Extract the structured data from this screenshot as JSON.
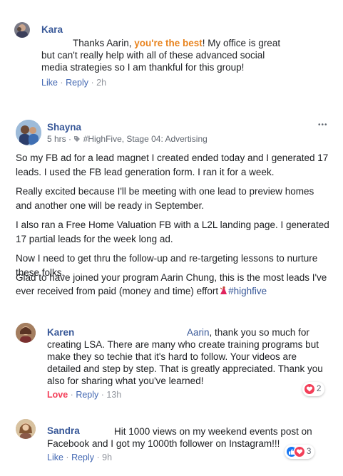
{
  "comment1": {
    "author": "Kara",
    "text_pre": "Thanks Aarin, ",
    "text_highlight": "you're the best",
    "text_post": "! My office is great",
    "line2": "but can't really help with all of these advanced social",
    "line3": "media strategies so I am thankful for this group!",
    "like": "Like",
    "reply": "Reply",
    "time": "2h"
  },
  "post": {
    "author": "Shayna",
    "time": "5 hrs",
    "tag": "#HighFive, Stage 04: Advertising",
    "more": "•••",
    "p1_l1": "So my FB ad for a lead magnet I created ended today and I generated 17",
    "p1_l2": "leads. I used the FB lead generation form. I ran it for a week.",
    "p2_l1": "Really excited because I'll be meeting with one lead to preview homes",
    "p2_l2": "and another one will be ready in September.",
    "p3_l1": "I also ran a Free Home Valuation FB with a L2L landing page. I generated",
    "p3_l2": "17 partial leads for the week long ad.",
    "p4_l1": "Now I need to get thru the follow-up and re-targeting lessons to nurture",
    "p4_l2": "these folks.",
    "p5_l1": "Glad to have joined your program Aarin Chung, this is the most leads I've",
    "p5_l2_pre": "ever received from paid (money and time) effort",
    "p5_hashtag": "#highfive"
  },
  "comment2": {
    "author": "Karen",
    "mention": "Aarin",
    "line1_rest": ", thank you so much for",
    "line2": "creating LSA. There are many who create training programs but",
    "line3": "make they so techie that it's hard to follow. Your videos are",
    "line4": "detailed and step by step. That is greatly appreciated. Thank you",
    "line5": "also for sharing what you've learned!",
    "love": "Love",
    "reply": "Reply",
    "time": "13h",
    "reaction_count": "2"
  },
  "comment3": {
    "author": "Sandra",
    "line1": "Hit 1000 views on my weekend events post on",
    "line2": "Facebook and I got my 1000th follower on Instagram!!!",
    "like": "Like",
    "reply": "Reply",
    "time": "9h",
    "reaction_count": "3"
  },
  "colors": {
    "link": "#385898",
    "action": "#4267b2",
    "highlight": "#e8831e",
    "love": "#f33e58",
    "meta": "#90949c"
  }
}
